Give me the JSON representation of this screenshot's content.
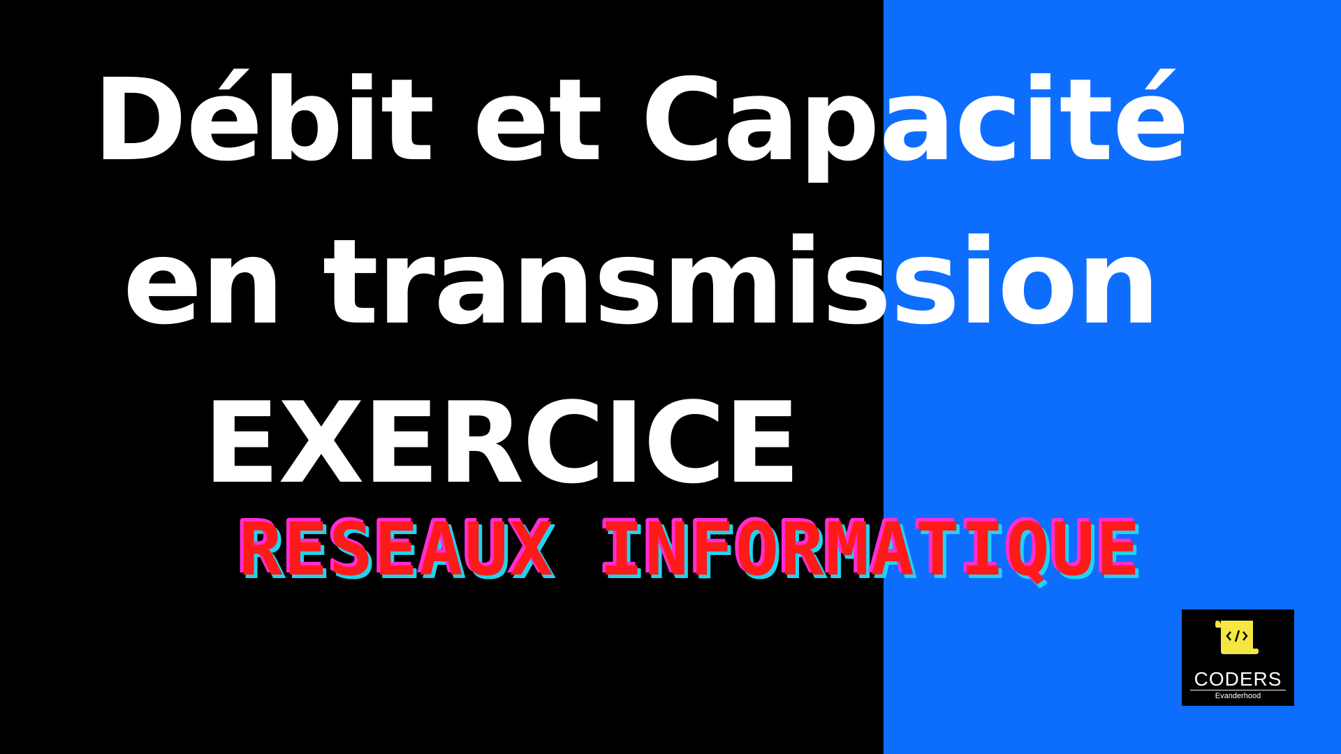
{
  "title": {
    "line1": "Débit et Capacité",
    "line2": "en transmission",
    "line3": "EXERCICE"
  },
  "subtitle": "RESEAUX INFORMATIQUE",
  "logo": {
    "icon": "code-scroll-icon",
    "name": "CODERS",
    "tagline": "Evanderhood"
  },
  "colors": {
    "left_background": "#000000",
    "right_background": "#0d6efd",
    "title_text": "#ffffff",
    "subtitle_fill": "#ff1a1a",
    "subtitle_shadow_1": "#ff2bd4",
    "subtitle_shadow_2": "#22d3ee",
    "logo_accent": "#f5e642"
  }
}
